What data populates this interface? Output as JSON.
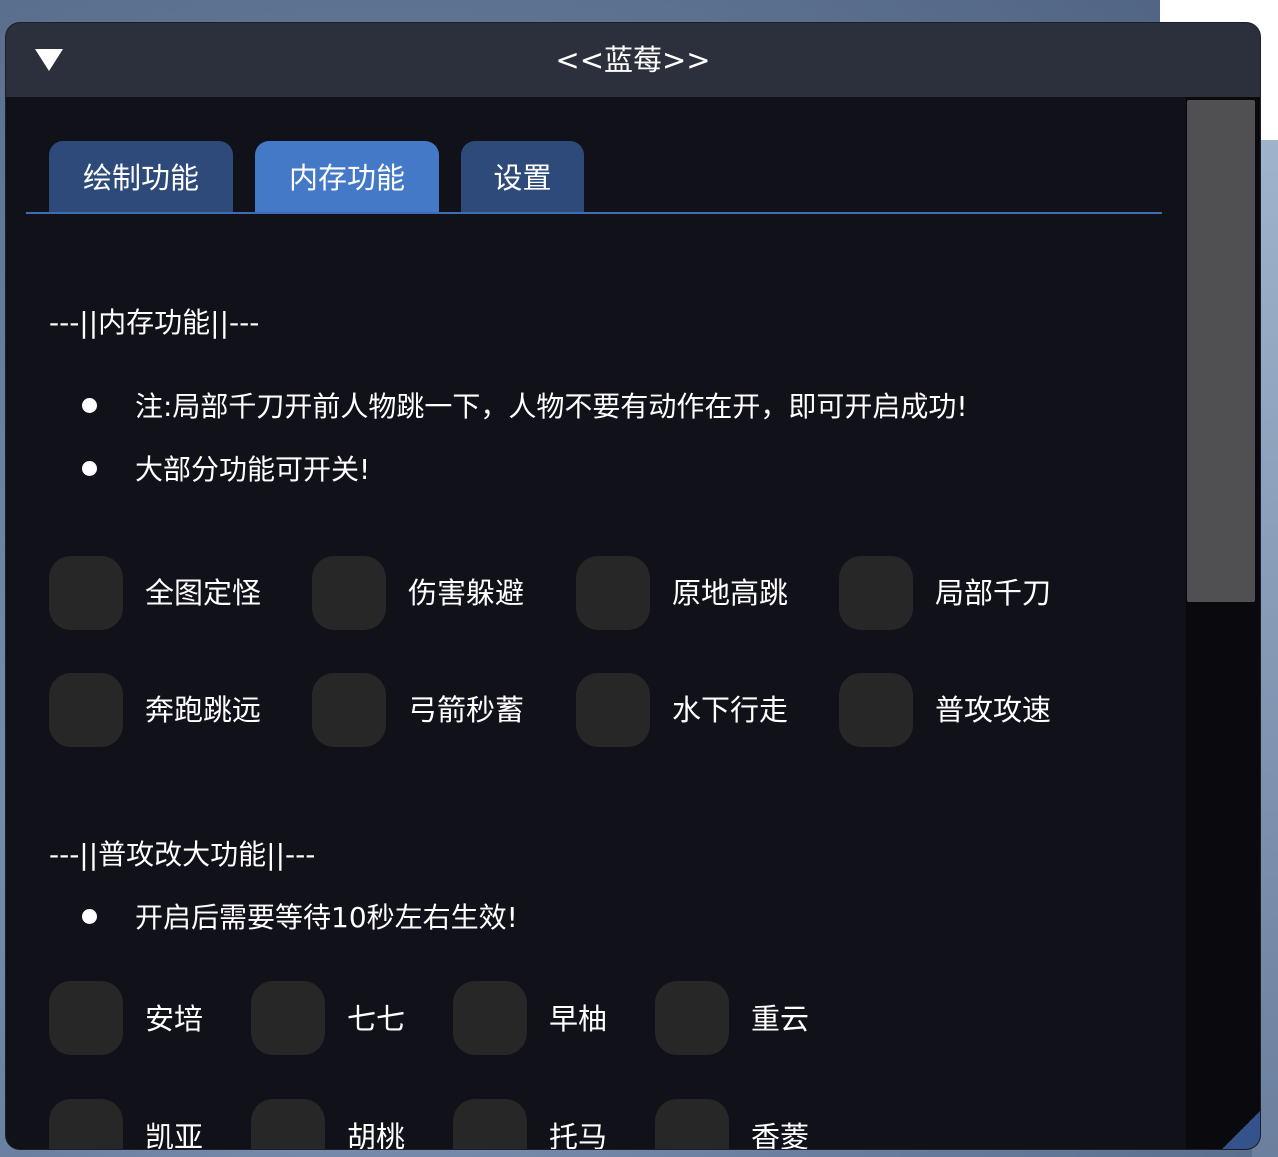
{
  "window": {
    "title": "<<蓝莓>>"
  },
  "tabs": [
    {
      "label": "绘制功能",
      "active": false
    },
    {
      "label": "内存功能",
      "active": true
    },
    {
      "label": "设置",
      "active": false
    }
  ],
  "memory_section": {
    "header": "---||内存功能||---",
    "notes": [
      "注:局部千刀开前人物跳一下，人物不要有动作在开，即可开启成功!",
      "大部分功能可开关!"
    ],
    "toggles": [
      "全图定怪",
      "伤害躲避",
      "原地高跳",
      "局部千刀",
      "奔跑跳远",
      "弓箭秒蓄",
      "水下行走",
      "普攻攻速"
    ]
  },
  "attack_section": {
    "header": "---||普攻改大功能||---",
    "notes": [
      "开启后需要等待10秒左右生效!"
    ],
    "toggles": [
      "安培",
      "七七",
      "早柚",
      "重云",
      "凯亚",
      "胡桃",
      "托马",
      "香菱"
    ]
  },
  "colors": {
    "window_bg": "#101119",
    "titlebar": "#2c303c",
    "tab_inactive": "#2d4a7a",
    "tab_active": "#4479c8",
    "checkbox": "#272727"
  },
  "icons": {
    "collapse": "triangle-down-icon"
  }
}
